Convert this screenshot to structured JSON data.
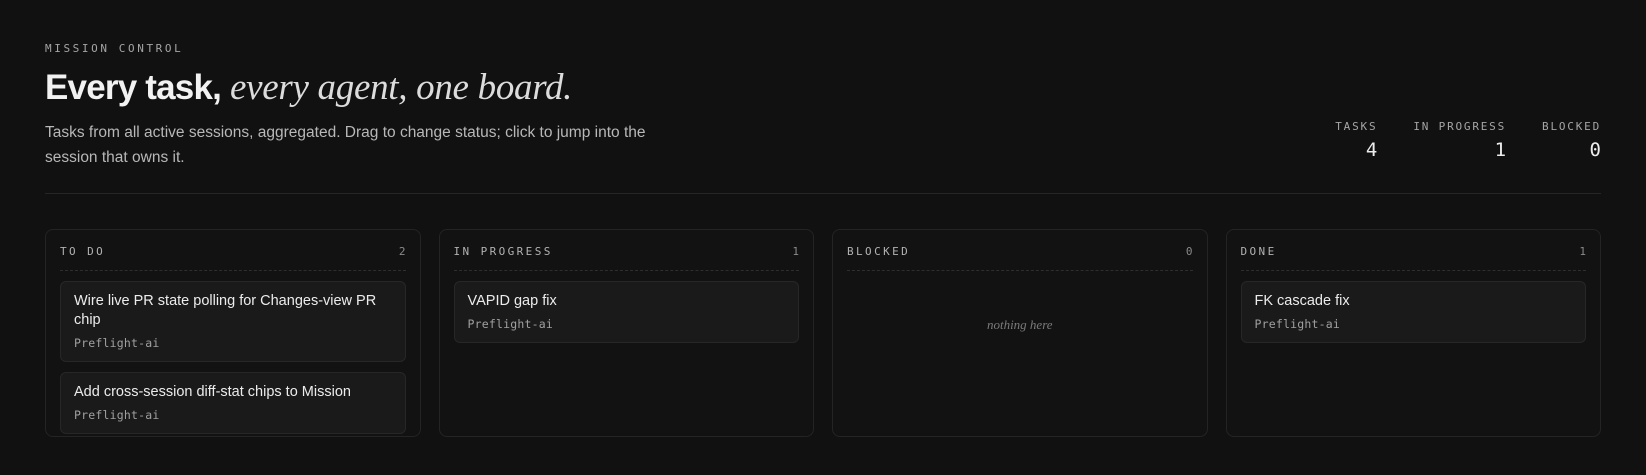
{
  "header": {
    "eyebrow": "MISSION CONTROL",
    "headline_strong": "Every task,",
    "headline_serif": " every agent, one board.",
    "subtitle": "Tasks from all active sessions, aggregated. Drag to change status; click to jump into the session that owns it."
  },
  "stats": [
    {
      "label": "TASKS",
      "value": "4"
    },
    {
      "label": "IN PROGRESS",
      "value": "1"
    },
    {
      "label": "BLOCKED",
      "value": "0"
    }
  ],
  "columns": [
    {
      "title": "TO DO",
      "count": "2",
      "cards": [
        {
          "title": "Wire live PR state polling for Changes-view PR chip",
          "meta": "Preflight-ai"
        },
        {
          "title": "Add cross-session diff-stat chips to Mission",
          "meta": "Preflight-ai"
        }
      ]
    },
    {
      "title": "IN PROGRESS",
      "count": "1",
      "cards": [
        {
          "title": "VAPID gap fix",
          "meta": "Preflight-ai"
        }
      ]
    },
    {
      "title": "BLOCKED",
      "count": "0",
      "empty_text": "nothing here",
      "cards": []
    },
    {
      "title": "DONE",
      "count": "1",
      "cards": [
        {
          "title": "FK cascade fix",
          "meta": "Preflight-ai"
        }
      ]
    }
  ]
}
